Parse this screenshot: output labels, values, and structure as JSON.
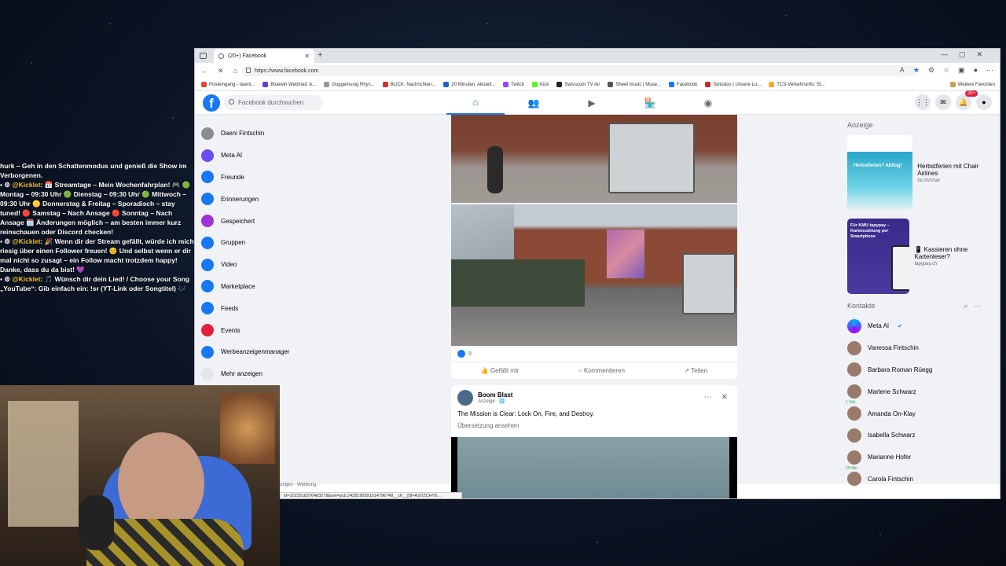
{
  "chat": [
    {
      "user": "",
      "text": "hurk – Geh in den Schattenmodus und genieß die Show im Verborgenen."
    },
    {
      "user": "@Kicklet",
      "text": ": 📅 Streamtage – Mein Wochenfahrplan! 🎮 🟢 Montag – 09:30 Uhr 🟢 Dienstag – 09:30 Uhr 🟢 Mittwoch – 09:30 Uhr 🟡 Donnerstag & Freitag – Sporadisch – stay tuned! 🔴 Samstag – Nach Ansage 🔴 Sonntag – Nach Ansage 🗓️ Änderungen möglich – am besten immer kurz reinschauen oder Discord checken!"
    },
    {
      "user": "@Kicklet",
      "text": ": 🎉 Wenn dir der Stream gefällt, würde ich mich riesig über einen Follower freuen! 😊 Und selbst wenn er dir mal nicht so zusagt – ein Follow macht trotzdem happy! Danke, dass du da bist! 💜"
    },
    {
      "user": "@Kicklet",
      "text": ": 🎵 Wünsch dir dein Lied! / Choose your Song „YouTube“: Gib einfach ein: !sr (YT-Link oder Songtitel) 🎶"
    }
  ],
  "browser": {
    "tab_title": "(20+) Facebook",
    "url": "https://www.facebook.com",
    "bookmarks": [
      "Posteingang - daeni...",
      "Bluewin Webmail: A...",
      "Guggemusig Rhys...",
      "BLICK: Nachrichten...",
      "20 Minuten: Aktuell...",
      "Twitch",
      "Kick",
      "Swisscom TV Air",
      "Sheet music | Muse...",
      "Facebook",
      "Swisslos | Unsere Lo...",
      "TCS-Verkehrsinfo: St..."
    ],
    "other_bookmarks": "Weitere Favoriten"
  },
  "facebook": {
    "logo": "f",
    "search_placeholder": "Facebook durchsuchen",
    "notifications_badge": "20+",
    "left_nav": [
      {
        "label": "Daeni Fintschin",
        "icon": "avatar-icon",
        "color": "#8a8d91"
      },
      {
        "label": "Meta AI",
        "icon": "meta-ai-icon",
        "color": "#6a4cf0"
      },
      {
        "label": "Freunde",
        "icon": "friends-icon",
        "color": "#1877f2"
      },
      {
        "label": "Erinnerungen",
        "icon": "memories-icon",
        "color": "#1877f2"
      },
      {
        "label": "Gespeichert",
        "icon": "bookmark-icon",
        "color": "#a033d6"
      },
      {
        "label": "Gruppen",
        "icon": "groups-icon",
        "color": "#1877f2"
      },
      {
        "label": "Video",
        "icon": "video-icon",
        "color": "#1877f2"
      },
      {
        "label": "Marketplace",
        "icon": "marketplace-icon",
        "color": "#1877f2"
      },
      {
        "label": "Feeds",
        "icon": "feeds-icon",
        "color": "#1877f2"
      },
      {
        "label": "Events",
        "icon": "events-icon",
        "color": "#e41e3f"
      },
      {
        "label": "Werbeanzeigenmanager",
        "icon": "ads-manager-icon",
        "color": "#1877f2"
      },
      {
        "label": "Mehr anzeigen",
        "icon": "chevron-down-icon",
        "color": "#e4e6eb"
      }
    ],
    "post1": {
      "reactions_count": "9",
      "like_label": "Gefällt mir",
      "comment_label": "Kommentieren",
      "share_label": "Teilen"
    },
    "post2": {
      "author": "Boom Blast",
      "sub": "Anzeige · 🌐",
      "text": "The Mission is Clear: Lock On, Fire, and Destroy.",
      "translate": "Übersetzung ansehen"
    },
    "sponsored_header": "Anzeige",
    "ads": [
      {
        "title": "Herbstferien mit Chair Airlines",
        "url": "tui.ch/chair",
        "image_text": "Herbstferien? Abflug!",
        "color": "#2aa7c9"
      },
      {
        "title": "📱 Kassieren ohne Kartenleser?",
        "url": "tapypay.ch",
        "image_text": "Für KMU tapypay – Kartenzahlung per Smartphone",
        "color": "#3a2a8a"
      }
    ],
    "contacts_header": "Kontakte",
    "contacts": [
      {
        "name": "Meta AI",
        "verified": true
      },
      {
        "name": "Vanessa Fintschin",
        "verified": false
      },
      {
        "name": "Barbara Roman Rüegg",
        "verified": false
      },
      {
        "name": "Marlene Schwarz",
        "verified": false,
        "status": "1 Std."
      },
      {
        "name": "Amanda On-Klay",
        "verified": false
      },
      {
        "name": "Isabella Schwarz",
        "verified": false
      },
      {
        "name": "Marianne Hofer",
        "verified": false,
        "status": "29 Min."
      },
      {
        "name": "Carola Fintschin",
        "verified": false
      }
    ],
    "footer_fragment": "ungen · Werbung ·",
    "status_link": "id=1023518376483279&set=pcb.2428190591514796748__cft__[0]=AZVZCHY6..."
  }
}
